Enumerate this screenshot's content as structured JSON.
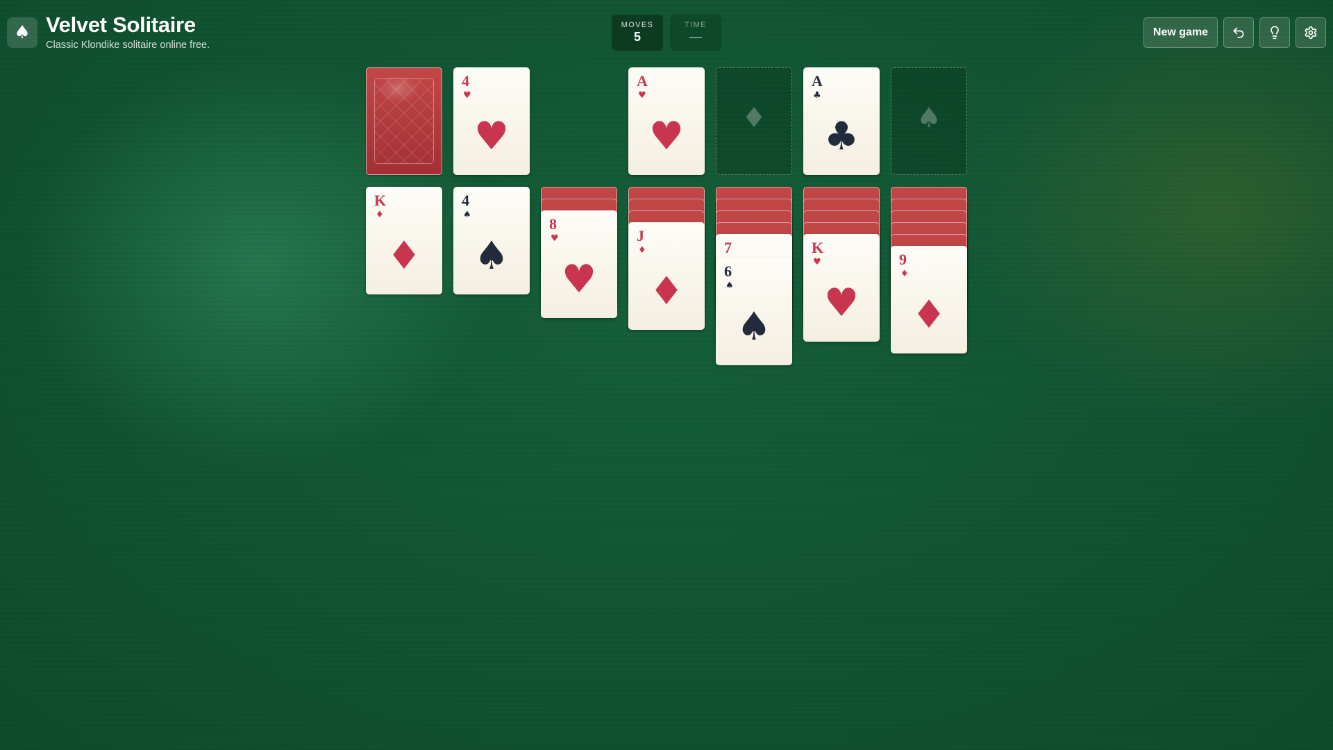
{
  "app": {
    "logo_glyph": "♠",
    "title": "Velvet Solitaire",
    "subtitle": "Classic Klondike solitaire online free."
  },
  "stats": {
    "moves_label": "MOVES",
    "moves_value": "5",
    "time_label": "TIME",
    "time_value": "—"
  },
  "toolbar": {
    "new_game_label": "New game",
    "undo_icon": "undo-icon",
    "hint_icon": "lightbulb-icon",
    "settings_icon": "gear-icon"
  },
  "colors": {
    "felt": "#125634",
    "card_red": "#c9344e",
    "card_black": "#222b3b",
    "card_back": "#b53c40"
  },
  "stock": {
    "face_down": true
  },
  "waste": {
    "rank": "4",
    "suit": "♥",
    "color": "red"
  },
  "foundations": [
    {
      "rank": "A",
      "suit": "♥",
      "color": "red",
      "empty": false
    },
    {
      "rank": "",
      "suit": "♦",
      "color": "red",
      "empty": true
    },
    {
      "rank": "A",
      "suit": "♣",
      "color": "black",
      "empty": false
    },
    {
      "rank": "",
      "suit": "♠",
      "color": "black",
      "empty": true
    }
  ],
  "tableau": [
    {
      "face_down": 0,
      "cards": [
        {
          "rank": "K",
          "suit": "♦",
          "color": "red"
        }
      ]
    },
    {
      "face_down": 0,
      "cards": [
        {
          "rank": "4",
          "suit": "♠",
          "color": "black"
        }
      ]
    },
    {
      "face_down": 2,
      "cards": [
        {
          "rank": "8",
          "suit": "♥",
          "color": "red"
        }
      ]
    },
    {
      "face_down": 3,
      "cards": [
        {
          "rank": "J",
          "suit": "♦",
          "color": "red"
        }
      ]
    },
    {
      "face_down": 4,
      "cards": [
        {
          "rank": "7",
          "suit": "♥",
          "color": "red"
        },
        {
          "rank": "6",
          "suit": "♠",
          "color": "black"
        }
      ]
    },
    {
      "face_down": 4,
      "cards": [
        {
          "rank": "K",
          "suit": "♥",
          "color": "red"
        }
      ]
    },
    {
      "face_down": 5,
      "cards": [
        {
          "rank": "9",
          "suit": "♦",
          "color": "red"
        }
      ]
    }
  ]
}
